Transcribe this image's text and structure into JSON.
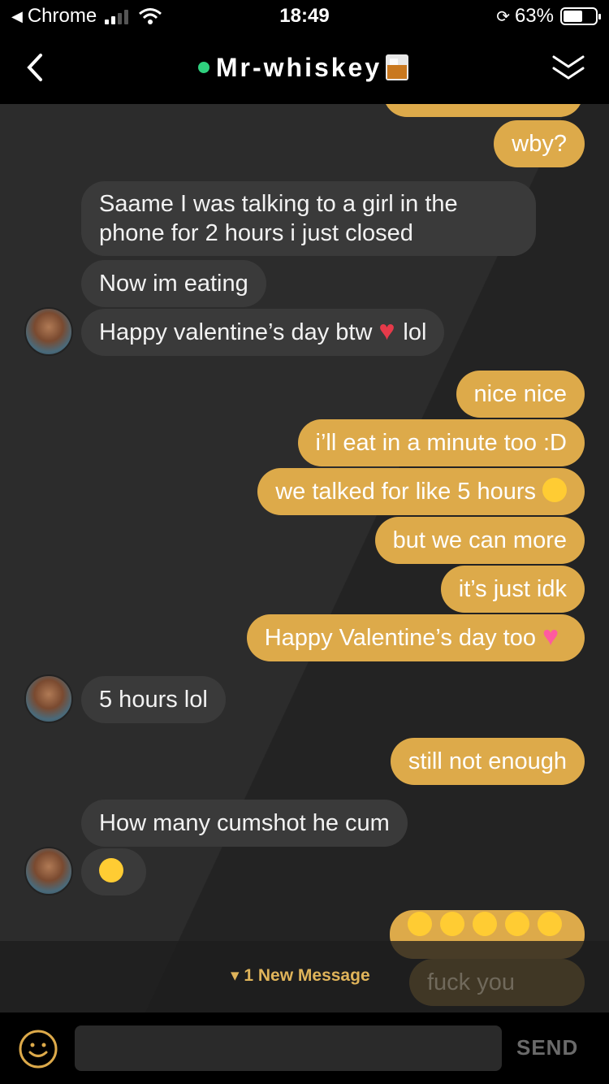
{
  "status_bar": {
    "back_app": "Chrome",
    "time": "18:49",
    "battery": "63%"
  },
  "header": {
    "title": "Mr-whiskey",
    "online": true
  },
  "messages": [
    {
      "side": "out",
      "text": "wby?"
    },
    {
      "side": "in",
      "text": "Saame I was talking to a girl in the phone for 2 hours i just closed"
    },
    {
      "side": "in",
      "text": "Now im eating"
    },
    {
      "side": "in",
      "text": "Happy valentine’s day btw",
      "suffix": "lol",
      "emoji": "heart-on-fire"
    },
    {
      "side": "out",
      "text": "nice nice"
    },
    {
      "side": "out",
      "text": "i’ll eat in a minute too :D"
    },
    {
      "side": "out",
      "text": "we talked for like 5 hours",
      "emoji": "sweat-smile"
    },
    {
      "side": "out",
      "text": "but we can more"
    },
    {
      "side": "out",
      "text": "it’s just idk"
    },
    {
      "side": "out",
      "text": "Happy Valentine’s day too",
      "emoji": "two-hearts"
    },
    {
      "side": "in",
      "text": "5 hours lol"
    },
    {
      "side": "out",
      "text": "still not enough"
    },
    {
      "side": "in",
      "text": "How many cumshot he cum"
    },
    {
      "side": "in",
      "text": "",
      "emoji": "tears-of-joy"
    },
    {
      "side": "out",
      "text": "",
      "emoji": "tears-of-joy x5"
    }
  ],
  "new_message_bar": {
    "label": "▾ 1 New Message",
    "preview": "fuck you"
  },
  "composer": {
    "placeholder": "",
    "send_label": "SEND"
  },
  "colors": {
    "outgoing": "#ddaa4a",
    "incoming": "#3a3a3a",
    "accent": "#e0b45a",
    "online": "#2fd07e"
  }
}
